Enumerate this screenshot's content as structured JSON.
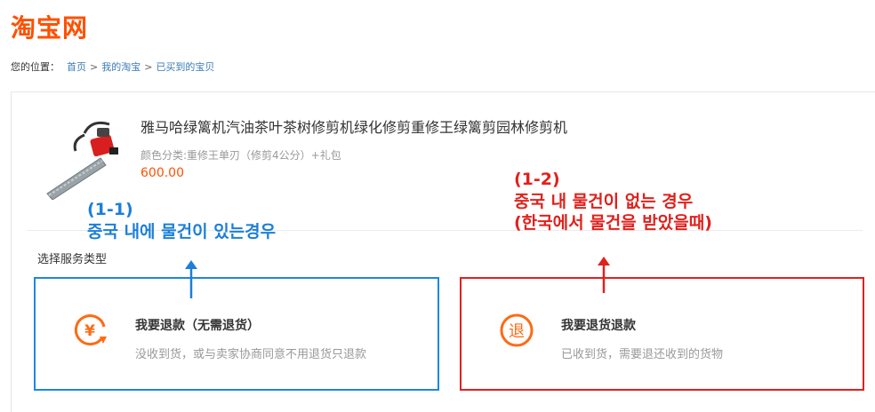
{
  "logo": {
    "text": "淘宝网",
    "color": "#ff5000"
  },
  "breadcrumb": {
    "lead": "您的位置：",
    "items": [
      "首页",
      "我的淘宝",
      "已买到的宝贝"
    ],
    "separator": ">"
  },
  "product": {
    "title": "雅马哈绿篱机汽油茶叶茶树修剪机绿化修剪重修王绿篱剪园林修剪机",
    "spec": "颜色分类:重修王单刃（修剪4公分）+礼包",
    "price": "600.00",
    "image_icon": "hedge-trimmer-image"
  },
  "service": {
    "label": "选择服务类型",
    "options": [
      {
        "title": "我要退款（无需退货）",
        "desc": "没收到货，或与卖家协商同意不用退货只退款",
        "icon": "yen-refund-icon",
        "border_color": "#1c88e0"
      },
      {
        "title": "我要退货退款",
        "desc": "已收到货，需要退还收到的货物",
        "icon": "return-icon",
        "icon_char": "退",
        "border_color": "#e02020"
      }
    ]
  },
  "annotations": {
    "blue": {
      "line1": "(1-1)",
      "line2": "중국 내에 물건이 있는경우",
      "color": "#1c7fd8"
    },
    "red": {
      "line1": "(1-2)",
      "line2": "중국 내 물건이 없는 경우",
      "line3": "(한국에서 물건을 받았을때)",
      "color": "#e0211c"
    }
  }
}
